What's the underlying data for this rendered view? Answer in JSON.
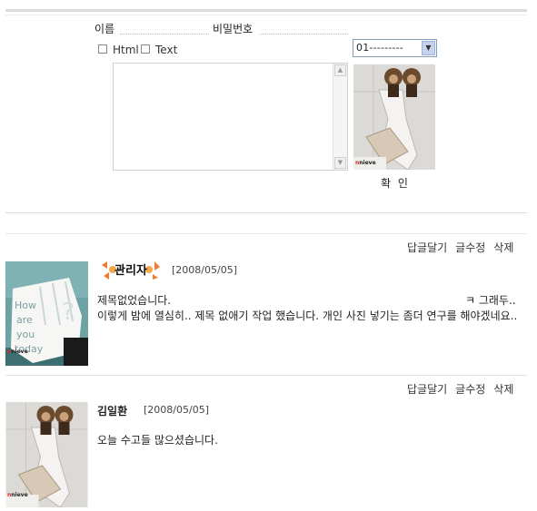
{
  "form": {
    "name_label": "이름",
    "password_label": "비밀번호",
    "html_label": "Html",
    "text_label": "Text",
    "select_value": "01---------",
    "submit_label": "확 인"
  },
  "photo_brand": "nieve",
  "posts": [
    {
      "actions": [
        "답글달기",
        "글수정",
        "삭제"
      ],
      "author_badge": "관리자",
      "date": "[2008/05/05]",
      "line1": "제목없었습니다.",
      "line1_tail": "ㅋ 그래두..",
      "line2": "이렇게 밤에 열심히.. 제목 없애기 작업 했습니다. 개인 사진 넣기는 좀더 연구를 해야겠네요..",
      "photo_text": [
        "How",
        "are",
        "you",
        "today"
      ]
    },
    {
      "actions": [
        "답글달기",
        "글수정",
        "삭제"
      ],
      "author": "김일환",
      "date": "[2008/05/05]",
      "line1": "오늘 수고들 많으셨습니다."
    }
  ]
}
